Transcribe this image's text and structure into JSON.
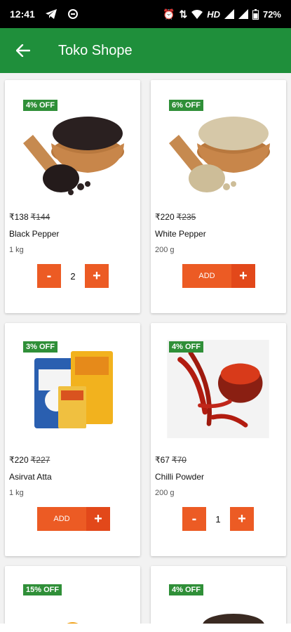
{
  "status_bar": {
    "time": "12:41",
    "left_icons": [
      "telegram-icon",
      "data-saver-icon"
    ],
    "right_icons": [
      "alarm-icon",
      "wifi-icon",
      "network-icon",
      "signal-icon",
      "battery-icon"
    ],
    "network_type": "HD",
    "battery": "72%"
  },
  "app_bar": {
    "title": "Toko Shope",
    "back_icon": "back-arrow-icon"
  },
  "colors": {
    "primary": "#1f8f3b",
    "accent": "#ec5b24",
    "badge": "#2f8f38"
  },
  "products": [
    {
      "discount": "4% OFF",
      "price": "₹138",
      "mrp": "₹144",
      "name": "Black Pepper",
      "qty": "1 kg",
      "in_cart": true,
      "count": "2",
      "image": "black-pepper-image"
    },
    {
      "discount": "6% OFF",
      "price": "₹220",
      "mrp": "₹235",
      "name": "White Pepper",
      "qty": "200 g",
      "in_cart": false,
      "add_label": "ADD",
      "image": "white-pepper-image"
    },
    {
      "discount": "3% OFF",
      "price": "₹220",
      "mrp": "₹227",
      "name": "Asirvat Atta",
      "qty": "1 kg",
      "in_cart": false,
      "add_label": "ADD",
      "image": "atta-pack-image"
    },
    {
      "discount": "4% OFF",
      "price": "₹67",
      "mrp": "₹70",
      "name": "Chilli Powder",
      "qty": "200 g",
      "in_cart": true,
      "count": "1",
      "image": "chilli-powder-image"
    },
    {
      "discount": "15% OFF",
      "image": "turmeric-image"
    },
    {
      "discount": "4% OFF",
      "image": "mustard-seeds-image"
    }
  ]
}
